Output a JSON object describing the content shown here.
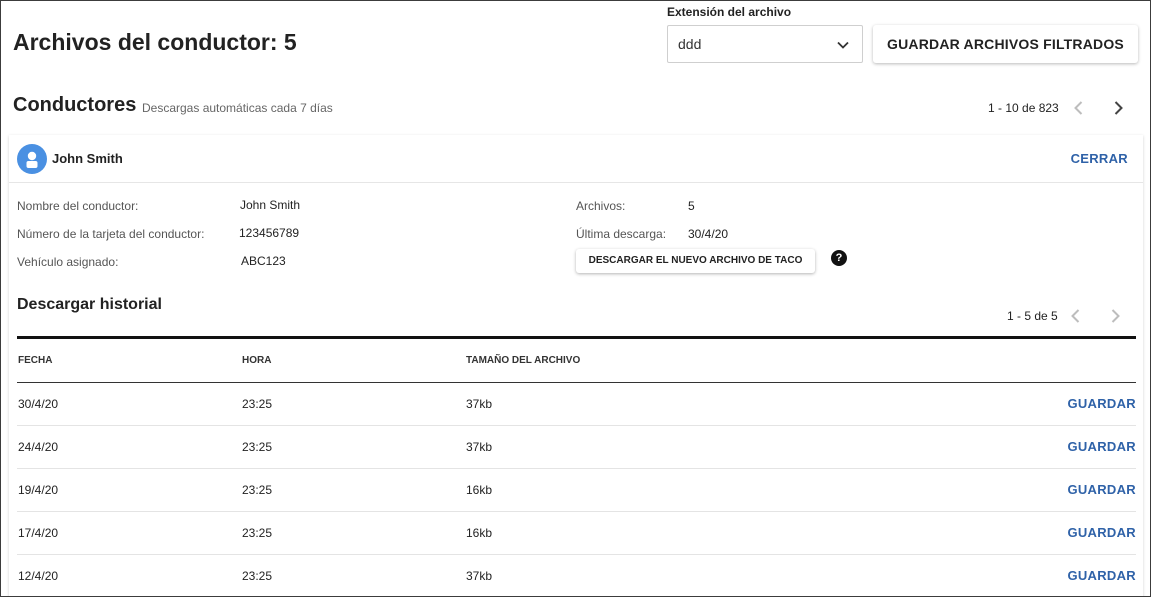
{
  "header": {
    "title": "Archivos del conductor: 5",
    "extension_label": "Extensión del archivo",
    "extension_value": "ddd",
    "save_filtered_label": "GUARDAR ARCHIVOS FILTRADOS"
  },
  "drivers_section": {
    "title": "Conductores",
    "subtitle": "Descargas automáticas cada 7 días",
    "pagination": "1 - 10 de 823"
  },
  "driver_card": {
    "name": "John Smith",
    "close_label": "CERRAR",
    "fields": {
      "name_label": "Nombre del conductor:",
      "name_value": "John Smith",
      "card_label": "Número de la tarjeta del conductor:",
      "card_value": "123456789",
      "vehicle_label": "Vehículo asignado:",
      "vehicle_value": "ABC123",
      "files_label": "Archivos:",
      "files_value": "5",
      "last_download_label": "Última descarga:",
      "last_download_value": "30/4/20"
    },
    "download_taco_label": "DESCARGAR EL NUEVO ARCHIVO DE TACO",
    "help_icon": "?"
  },
  "history": {
    "title": "Descargar historial",
    "pagination": "1 - 5 de 5",
    "columns": [
      "FECHA",
      "HORA",
      "TAMAÑO DEL ARCHIVO"
    ],
    "save_label": "GUARDAR",
    "rows": [
      {
        "fecha": "30/4/20",
        "hora": "23:25",
        "tamano": "37kb"
      },
      {
        "fecha": "24/4/20",
        "hora": "23:25",
        "tamano": "37kb"
      },
      {
        "fecha": "19/4/20",
        "hora": "23:25",
        "tamano": "16kb"
      },
      {
        "fecha": "17/4/20",
        "hora": "23:25",
        "tamano": "16kb"
      },
      {
        "fecha": "12/4/20",
        "hora": "23:25",
        "tamano": "37kb"
      }
    ]
  },
  "colors": {
    "accent": "#2f62a8",
    "avatar": "#4a90e2"
  }
}
